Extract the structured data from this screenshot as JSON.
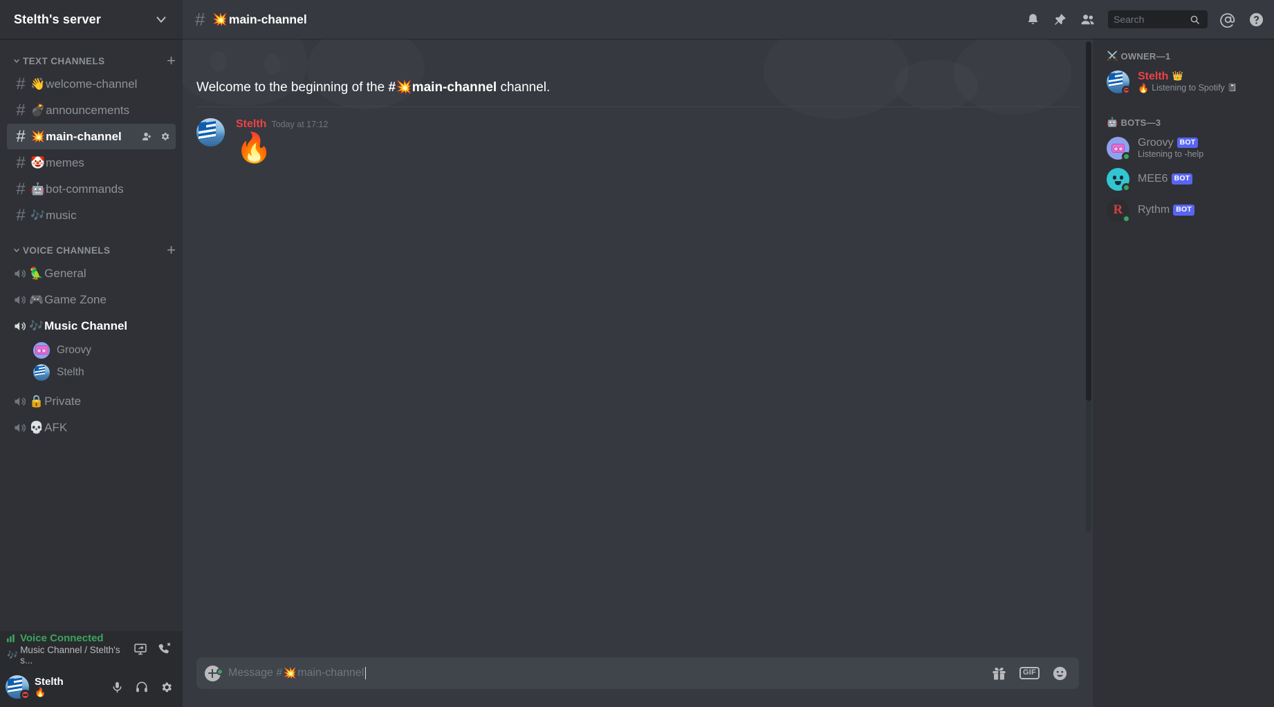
{
  "server": {
    "name": "Stelth's server",
    "dropdown_icon": "chevron-down-icon"
  },
  "sidebar": {
    "text_category": {
      "label": "TEXT CHANNELS",
      "add_label": "+"
    },
    "text_channels": [
      {
        "emoji": "👋",
        "name": "welcome-channel",
        "active": false
      },
      {
        "emoji": "💣",
        "name": "announcements",
        "active": false
      },
      {
        "emoji": "💥",
        "name": "main-channel",
        "active": true
      },
      {
        "emoji": "🤡",
        "name": "memes",
        "active": false
      },
      {
        "emoji": "🤖",
        "name": "bot-commands",
        "active": false
      },
      {
        "emoji": "🎶",
        "name": "music",
        "active": false
      }
    ],
    "voice_category": {
      "label": "VOICE CHANNELS",
      "add_label": "+"
    },
    "voice_channels": [
      {
        "emoji": "🦜",
        "name": "General",
        "active": false
      },
      {
        "emoji": "🎮",
        "name": "Game Zone",
        "active": false
      },
      {
        "emoji": "🎶",
        "name": "Music Channel",
        "active": true
      },
      {
        "emoji": "🔒",
        "name": "Private",
        "active": false
      },
      {
        "emoji": "💀",
        "name": "AFK",
        "active": false
      }
    ],
    "voice_members": [
      {
        "name": "Groovy",
        "avatar": "groovy-avatar"
      },
      {
        "name": "Stelth",
        "avatar": "greek-flag-avatar"
      }
    ]
  },
  "voice_panel": {
    "status": "Voice Connected",
    "signal_icon": "signal-bars-icon",
    "channel_emoji": "🎶",
    "channel_path": "Music Channel / Stelth's s...",
    "screen_share_icon": "screen-share-icon",
    "disconnect_icon": "disconnect-call-icon",
    "status_color": "#3ba55d"
  },
  "user_bar": {
    "name": "Stelth",
    "custom_status_emoji": "🔥",
    "presence": "dnd",
    "mic_icon": "microphone-icon",
    "headphones_icon": "headphones-icon",
    "settings_icon": "gear-icon"
  },
  "topbar": {
    "hash": "#",
    "channel_emoji": "💥",
    "channel_name": "main-channel",
    "icons": [
      "bell-icon",
      "pin-icon",
      "members-icon",
      "mentions-icon",
      "help-icon"
    ],
    "search": {
      "placeholder": "Search",
      "value": "",
      "icon": "search-icon"
    }
  },
  "chat": {
    "welcome": {
      "prefix": "Welcome to the beginning of the ",
      "hash": "#",
      "emoji": "💥",
      "channel": "main-channel",
      "suffix": " channel."
    },
    "messages": [
      {
        "author": "Stelth",
        "author_color": "#ed4245",
        "timestamp": "Today at 17:12",
        "content": "🔥",
        "avatar": "greek-flag-avatar"
      }
    ]
  },
  "composer": {
    "placeholder_prefix": "Message #",
    "placeholder_emoji": "💥",
    "placeholder_channel": "main-channel",
    "value": "",
    "attach_icon": "plus-circle-icon",
    "gift_icon": "gift-icon",
    "gif_label": "GIF",
    "emoji_icon": "emoji-smiley-icon"
  },
  "members": {
    "groups": [
      {
        "emoji": "⚔️",
        "label": "OWNER—1",
        "people": [
          {
            "name": "Stelth",
            "name_color": "#ed4245",
            "crown": "👑",
            "status_emoji": "🔥",
            "status_text": "Listening to Spotify",
            "status_trailing_icon": "📓",
            "presence": "dnd",
            "is_bot": false,
            "avatar": "greek-flag-avatar"
          }
        ]
      },
      {
        "emoji": "🤖",
        "label": "BOTS—3",
        "people": [
          {
            "name": "Groovy",
            "bot_tag": "BOT",
            "status_text": "Listening to -help",
            "presence": "online",
            "is_bot": true,
            "avatar": "groovy-avatar"
          },
          {
            "name": "MEE6",
            "bot_tag": "BOT",
            "status_text": "",
            "presence": "online",
            "is_bot": true,
            "avatar": "mee6-avatar"
          },
          {
            "name": "Rythm",
            "bot_tag": "BOT",
            "status_text": "",
            "presence": "online",
            "is_bot": true,
            "avatar": "rythm-avatar"
          }
        ]
      }
    ]
  },
  "colors": {
    "sidebar_bg": "#2f3136",
    "chat_bg": "#36393f",
    "dark_bg": "#202225",
    "panel_bg": "#292b2f",
    "accent_blurple": "#5865f2",
    "online_green": "#3ba55d",
    "dnd_red": "#ed4245",
    "text_muted": "#8e9297",
    "text_normal": "#dcddde"
  }
}
